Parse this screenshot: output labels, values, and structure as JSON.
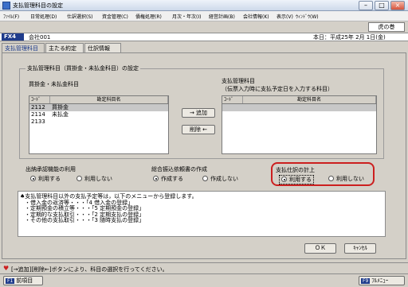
{
  "window": {
    "title": "支払管理科目の設定",
    "buttons": [
      "–",
      "□",
      "×"
    ]
  },
  "menu": [
    "ﾌｧｲﾙ(F)",
    "日常処理(D)",
    "仕訳選択(S)",
    "資金管理(C)",
    "債権処理(R)",
    "月次・年次(I)",
    "経営計画(B)",
    "会社情報(K)",
    "表示(V)",
    "ｳｨﾝﾄﾞｳ(W)"
  ],
  "toolbar": {
    "tora_button": "虎の巻"
  },
  "info": {
    "code": "FX4",
    "company": "会社001",
    "today": "本日：平成25年 2月 1日(金)"
  },
  "tabs": [
    "支払管理科目",
    "主たる約定",
    "仕訳情報"
  ],
  "settings": {
    "group_title": "支払管理科目（買掛金・未払金科目）の設定",
    "left_title": "買掛金・未払金科目",
    "right_title_1": "支払管理科目",
    "right_title_2": "（伝票入力時に支払予定日を入力する科目）",
    "col_code": "ｺｰﾄﾞ",
    "col_name": "勘定科目名",
    "left_rows": [
      {
        "code": "2112",
        "name": "買掛金"
      },
      {
        "code": "2114",
        "name": "未払金"
      },
      {
        "code": "2133",
        "name": ""
      }
    ],
    "add_button": "→ 追加",
    "delete_button": "削除 ←"
  },
  "options": {
    "approval": {
      "title": "出納承認機能の利用",
      "opt1": "利用する",
      "opt2": "利用しない"
    },
    "transfer": {
      "title": "総合振込依頼書の作成",
      "opt1": "作成する",
      "opt2": "作成しない"
    },
    "posting": {
      "title": "支払仕訳の計上",
      "opt1": "利用する",
      "opt2": "利用しない"
    }
  },
  "message": {
    "lines": [
      "♠支払管理科目以外の支払予定等は，以下のメニューから登録します。",
      "・借入金の返済等・・・「4 借入金の登録」",
      "・定期預金の積立等・・・「5 定期預金の登録」",
      "・定期的な支払取引・・・「2 定期支払の登録」",
      "・その他の支払取引・・・「3 随時支払の登録」"
    ]
  },
  "actions": {
    "ok": "ＯＫ",
    "cancel": "ｷｬﾝｾﾙ"
  },
  "status": {
    "text": "[→追加][削除←]ボタンにより、科目の選択を行ってください。"
  },
  "bottom": {
    "f1_key": "F1",
    "f1_label": "前項目",
    "f9_key": "F9",
    "f9_label": "ﾌﾙﾒﾆｭｰ"
  },
  "colors": {
    "fx_badge": "#1f3c8c",
    "highlight": "#cc1f1f",
    "selected_row": "#c8c8c8"
  }
}
